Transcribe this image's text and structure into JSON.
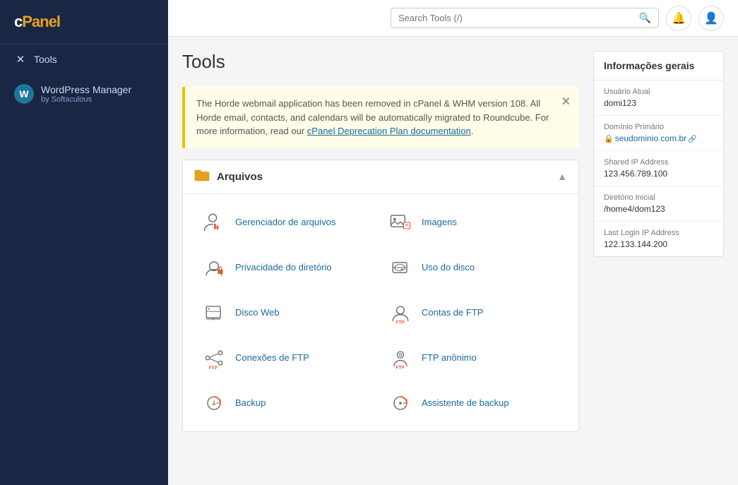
{
  "sidebar": {
    "logo": "cPanel",
    "logo_cp": "c",
    "logo_panel": "Panel",
    "items": [
      {
        "id": "tools",
        "label": "Tools",
        "icon": "✕"
      },
      {
        "id": "wordpress-manager",
        "title": "WordPress Manager",
        "subtitle": "by Softaculous"
      }
    ]
  },
  "header": {
    "search_placeholder": "Search Tools (/)",
    "search_shortcut": "(/)"
  },
  "page": {
    "title": "Tools"
  },
  "notice": {
    "text1": "The Horde webmail application has been removed in cPanel & WHM version 108. All Horde email, contacts, and calendars will be automatically migrated to Roundcube. For more information, read our ",
    "link_text": "cPanel Deprecation Plan documentation",
    "text2": "."
  },
  "sections": [
    {
      "id": "arquivos",
      "title": "Arquivos",
      "tools": [
        {
          "id": "file-manager",
          "label": "Gerenciador de arquivos"
        },
        {
          "id": "images",
          "label": "Imagens"
        },
        {
          "id": "directory-privacy",
          "label": "Privacidade do diretório"
        },
        {
          "id": "disk-usage",
          "label": "Uso do disco"
        },
        {
          "id": "web-disk",
          "label": "Disco Web"
        },
        {
          "id": "ftp-accounts",
          "label": "Contas de FTP"
        },
        {
          "id": "ftp-connections",
          "label": "Conexões de FTP"
        },
        {
          "id": "anonymous-ftp",
          "label": "FTP anônimo"
        },
        {
          "id": "backup",
          "label": "Backup"
        },
        {
          "id": "backup-wizard",
          "label": "Assistente de backup"
        }
      ]
    }
  ],
  "info_panel": {
    "title": "Informações gerais",
    "rows": [
      {
        "label": "Usuário Atual",
        "value": "domi123",
        "type": "text"
      },
      {
        "label": "Domínio Primário",
        "value": "seudominio.com.br",
        "type": "link"
      },
      {
        "label": "Shared IP Address",
        "value": "123.456.789.100",
        "type": "text"
      },
      {
        "label": "Diretório Inicial",
        "value": "/home4/dom123",
        "type": "text"
      },
      {
        "label": "Last Login IP Address",
        "value": "122.133.144.200",
        "type": "text"
      }
    ]
  }
}
